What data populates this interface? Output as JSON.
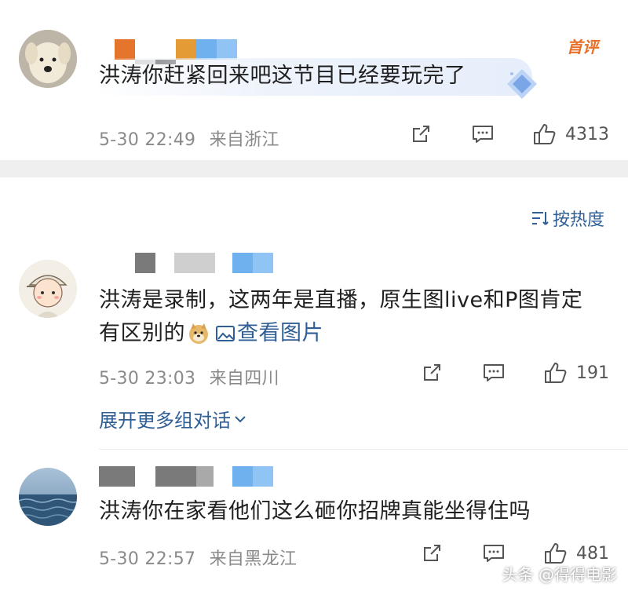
{
  "colors": {
    "link": "#2f5f96",
    "meta": "#8a8a8a",
    "first_badge": "#e8712a",
    "divider": "#efefef"
  },
  "comments": [
    {
      "text": "洪涛你赶紧回来吧这节目已经要玩完了",
      "badge": "首评",
      "time": "5-30 22:49",
      "location": "来自浙江",
      "likes": "4313",
      "avatar": "plush-dog-avatar"
    },
    {
      "text_line1": "洪涛是录制，这两年是直播，原生图live和P图肯定",
      "text_line2": "有区别的",
      "emoji": "doge-emoji",
      "image_link": "查看图片",
      "time": "5-30 23:03",
      "location": "来自四川",
      "likes": "191",
      "avatar": "cartoon-boy-avatar"
    },
    {
      "text": "洪涛你在家看他们这么砸你招牌真能坐得住吗",
      "time": "5-30 22:57",
      "location": "来自黑龙江",
      "likes": "481",
      "avatar": "sea-avatar"
    }
  ],
  "sort_label": "按热度",
  "expand_label": "展开更多组对话",
  "watermark": "头条 @得得电影"
}
